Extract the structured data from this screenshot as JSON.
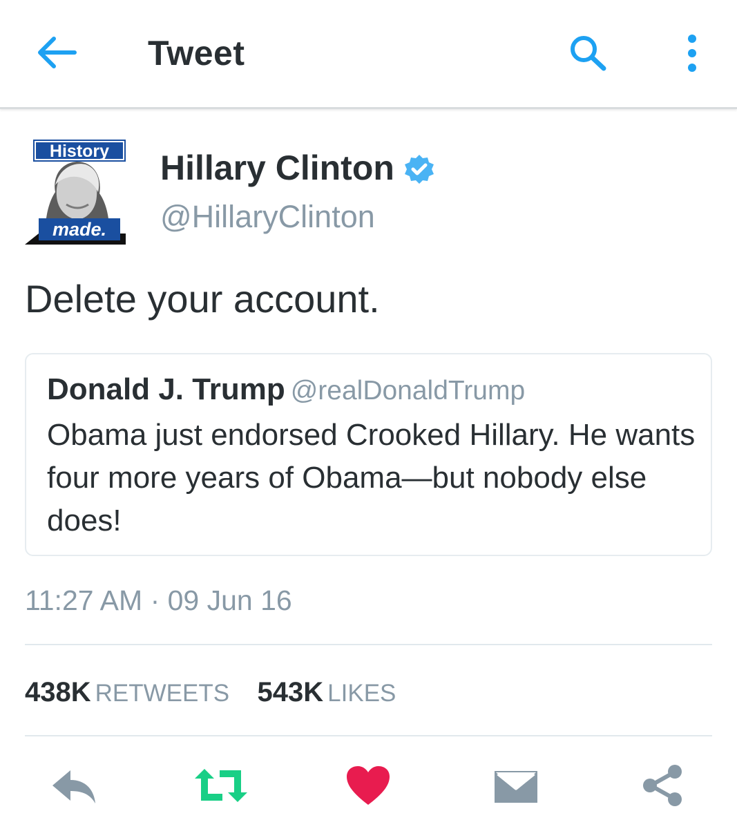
{
  "header": {
    "title": "Tweet"
  },
  "author": {
    "name": "Hillary Clinton",
    "handle": "@HillaryClinton",
    "avatar_badge_top": "History",
    "avatar_badge_bottom": "made."
  },
  "tweet": {
    "text": "Delete your account."
  },
  "quoted_tweet": {
    "name": "Donald J. Trump",
    "handle": "@realDonaldTrump",
    "text": "Obama just endorsed Crooked Hillary. He wants four more years of Obama—but nobody else does!"
  },
  "timestamp": "11:27 AM · 09 Jun 16",
  "stats": {
    "retweets_count": "438K",
    "retweets_label": "RETWEETS",
    "likes_count": "543K",
    "likes_label": "LIKES"
  },
  "actions": [
    {
      "icon": "reply-icon"
    },
    {
      "icon": "retweet-icon",
      "color": "#19cf86"
    },
    {
      "icon": "heart-icon",
      "color": "#e81c4f"
    },
    {
      "icon": "direct-message-icon"
    },
    {
      "icon": "share-icon"
    }
  ],
  "colors": {
    "accent": "#1da1f2",
    "muted": "#8899a6",
    "text": "#292f33",
    "icon_gray": "#8899a6"
  }
}
